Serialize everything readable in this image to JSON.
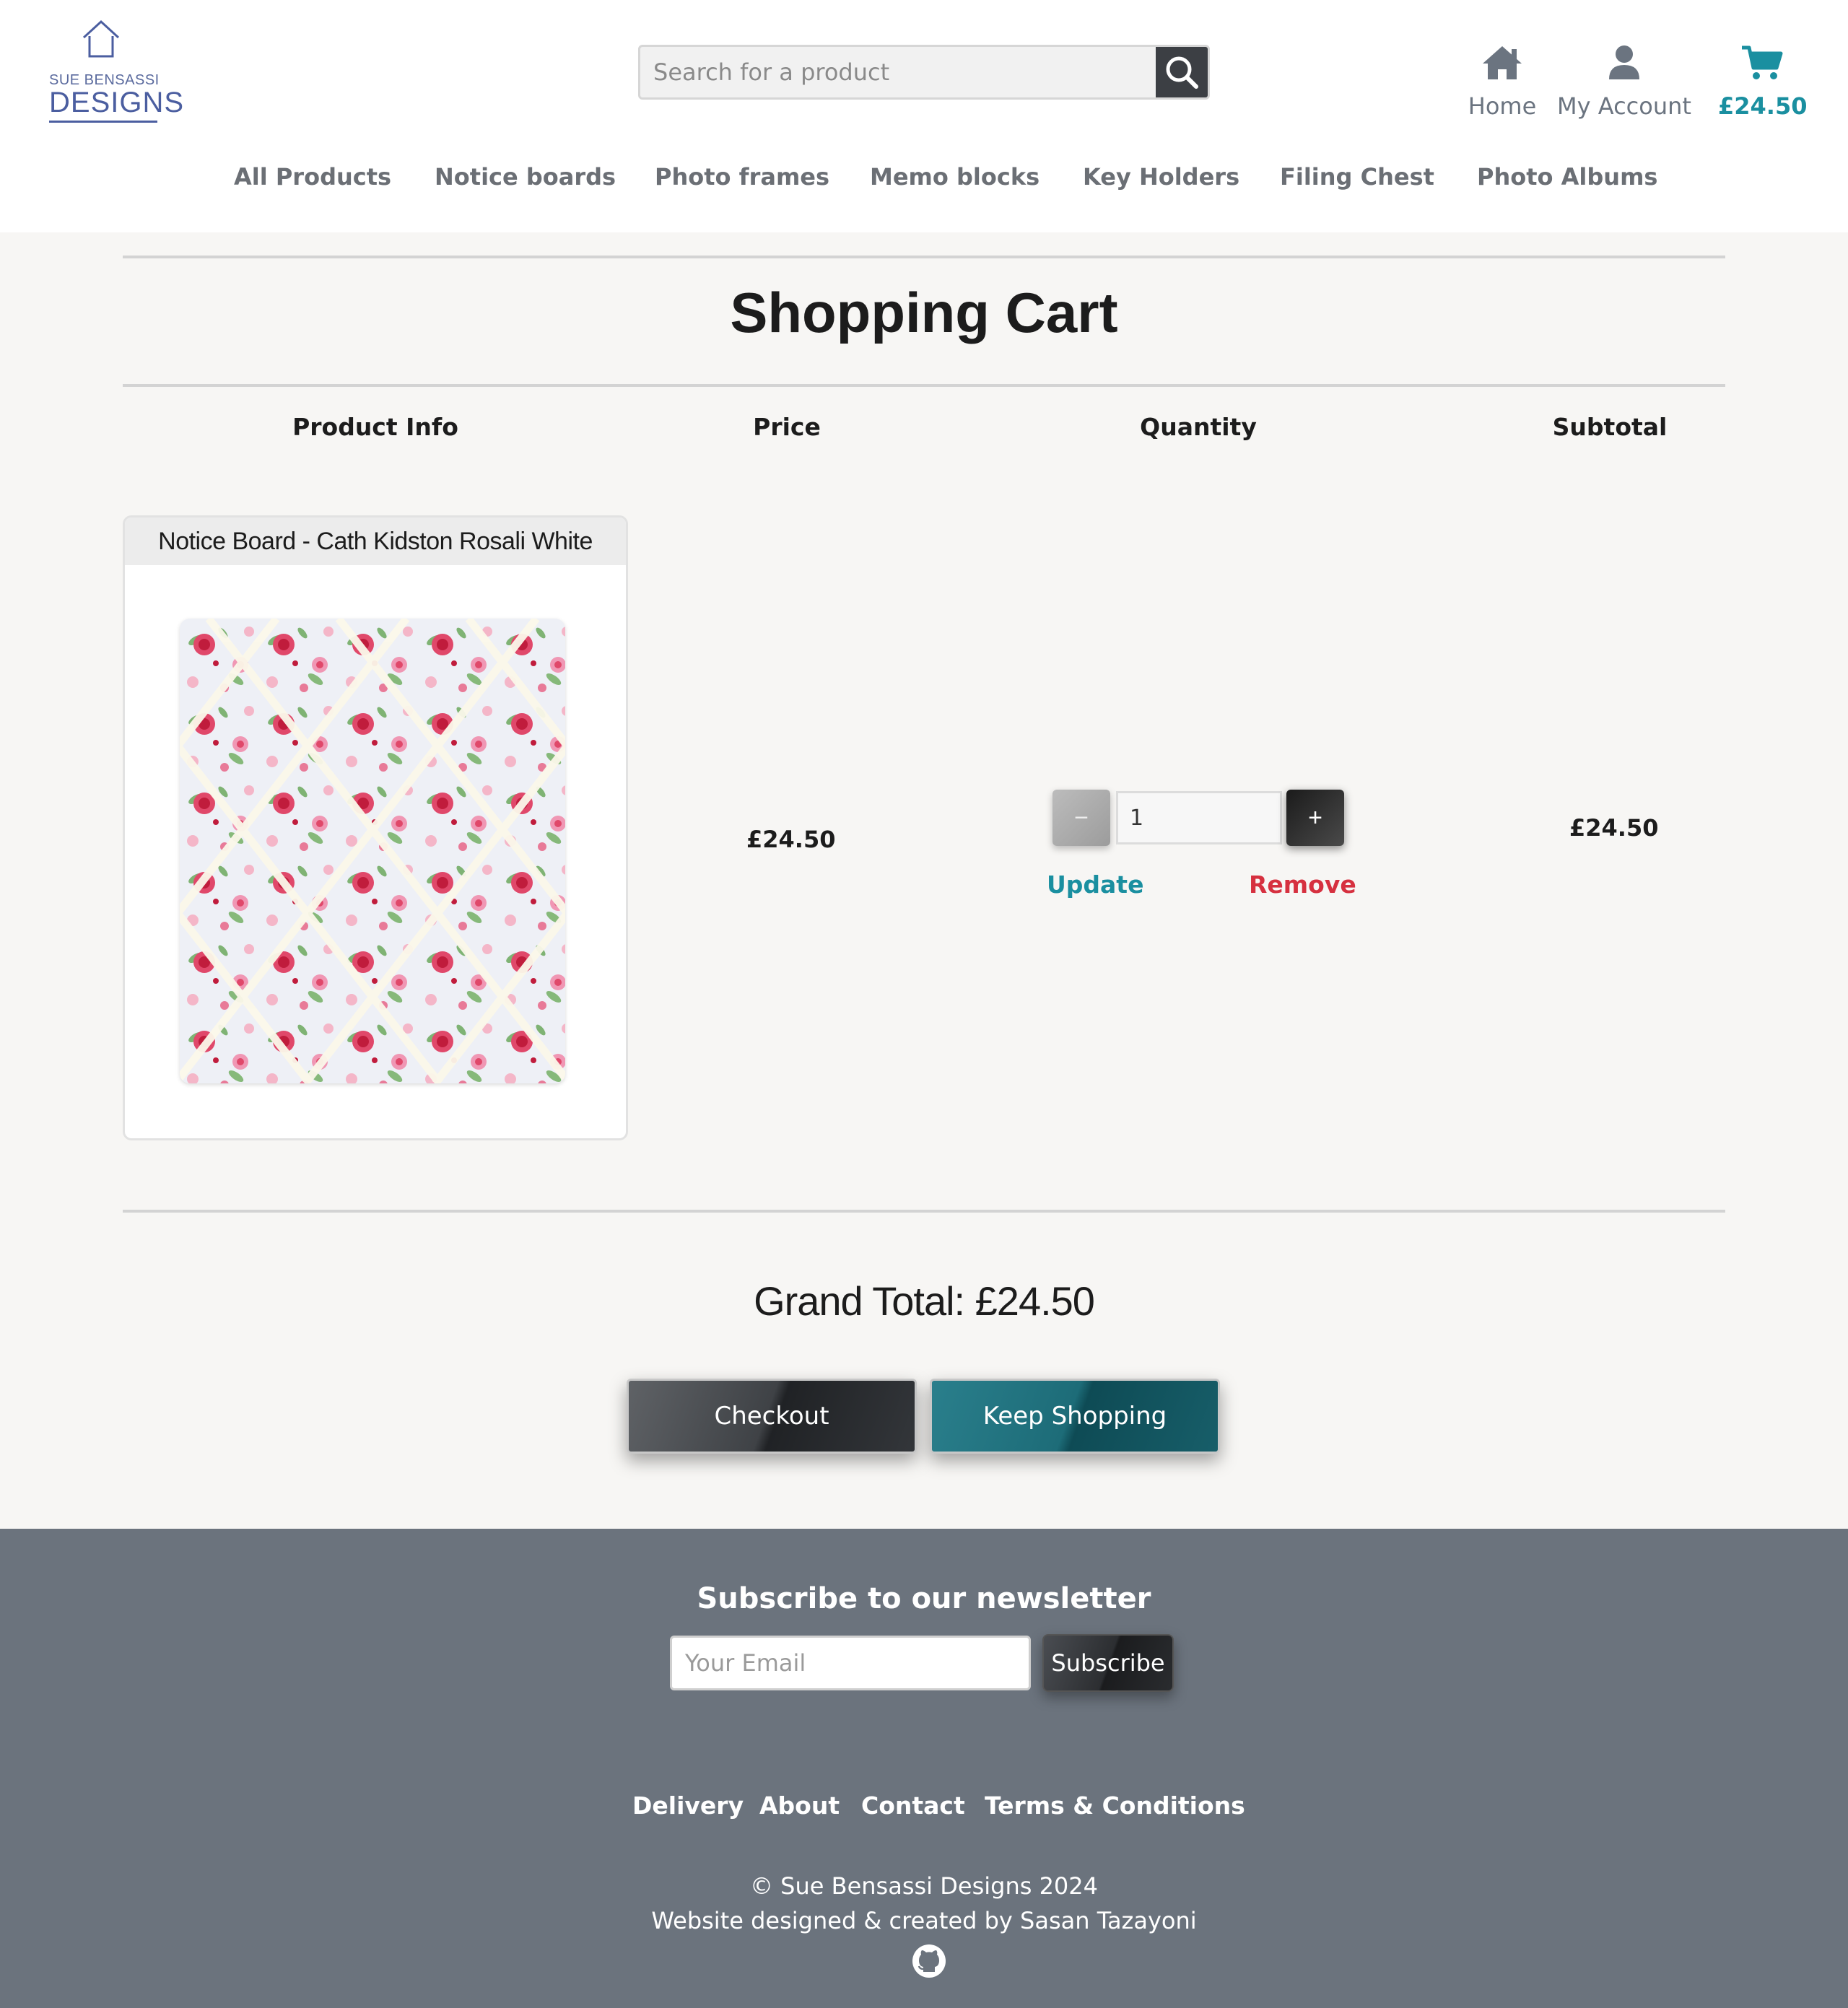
{
  "brand": {
    "small": "SUE BENSASSI",
    "big": "DESIGNS"
  },
  "search": {
    "placeholder": "Search for a product"
  },
  "header_nav": {
    "home": "Home",
    "account": "My Account",
    "cart_total": "£24.50"
  },
  "menu": [
    "All Products",
    "Notice boards",
    "Photo frames",
    "Memo blocks",
    "Key Holders",
    "Filing Chest",
    "Photo Albums"
  ],
  "page": {
    "title": "Shopping Cart"
  },
  "table": {
    "headers": [
      "Product Info",
      "Price",
      "Quantity",
      "Subtotal"
    ]
  },
  "cart_items": [
    {
      "name": "Notice Board - Cath Kidston Rosali White",
      "price": "£24.50",
      "quantity": "1",
      "subtotal": "£24.50",
      "update_label": "Update",
      "remove_label": "Remove",
      "minus_label": "−",
      "plus_label": "+"
    }
  ],
  "summary": {
    "grand_total": "Grand Total: £24.50",
    "checkout": "Checkout",
    "keep_shopping": "Keep Shopping"
  },
  "footer": {
    "newsletter_title": "Subscribe to our newsletter",
    "email_placeholder": "Your Email",
    "subscribe": "Subscribe",
    "links": [
      "Delivery",
      "About",
      "Contact",
      "Terms & Conditions"
    ],
    "copyright": "© Sue Bensassi Designs 2024",
    "credit": "Website designed & created by Sasan Tazayoni"
  },
  "colors": {
    "accent": "#1a8fa0",
    "danger": "#d6303f",
    "footer_bg": "#6b737d",
    "page_bg": "#f7f6f4"
  },
  "icons": [
    "house-logo-icon",
    "search-icon",
    "home-icon",
    "user-icon",
    "cart-icon",
    "github-icon"
  ]
}
